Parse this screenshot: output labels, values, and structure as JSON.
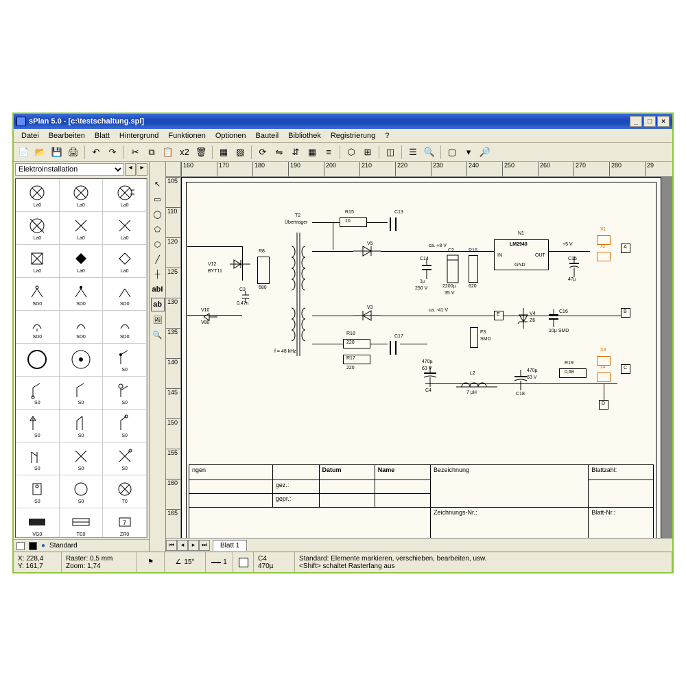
{
  "window": {
    "title": "sPlan 5.0 - [c:\\testschaltung.spl]",
    "min": "_",
    "max": "□",
    "close": "×"
  },
  "menu": [
    "Datei",
    "Bearbeiten",
    "Blatt",
    "Hintergrund",
    "Funktionen",
    "Optionen",
    "Bauteil",
    "Bibliothek",
    "Registrierung",
    "?"
  ],
  "library": {
    "selected": "Elektroinstallation",
    "components": [
      "La0",
      "La0",
      "La0",
      "La0",
      "La0",
      "La0",
      "La0",
      "La0",
      "La0",
      "SD0",
      "SD0",
      "SD0",
      "SD0",
      "SD0",
      "SD0",
      " ",
      " ",
      "S0",
      "S0",
      "S0",
      "S0",
      "S0",
      "S0",
      "S0",
      "S0",
      "S0",
      "S0",
      "S0",
      "S0",
      "T0",
      "VG0",
      "TE0",
      "ZR0"
    ]
  },
  "left_bottom": {
    "layer": "Standard"
  },
  "ruler_top": [
    "160",
    "170",
    "180",
    "190",
    "200",
    "210",
    "220",
    "230",
    "240",
    "250",
    "260",
    "270",
    "280",
    "29"
  ],
  "ruler_left": [
    "105",
    "110",
    "120",
    "125",
    "130",
    "135",
    "140",
    "145",
    "150",
    "155",
    "160",
    "165"
  ],
  "sheet_tab": "Blatt 1",
  "status": {
    "pos_x": "X: 228,4",
    "pos_y": "Y: 161,7",
    "raster": "Raster: 0,5 mm",
    "zoom": "Zoom:   1,74",
    "angle": "15°",
    "thick_lbl": "1",
    "sel_name": "C4",
    "sel_val": "470µ",
    "help1": "Standard: Elemente markieren, verschieben, bearbeiten, usw.",
    "help2": "<Shift> schaltet Rasterfang aus"
  },
  "schematic": {
    "t2": "T2",
    "t2s": "Übertrager",
    "r15": "R15",
    "r15v": "10",
    "c13": "C13",
    "v12": "V12",
    "v12v": "BYT11",
    "r8": "R8",
    "r8v": "680",
    "c3": "C3",
    "c3v": "0,47n",
    "v10": "V10",
    "v10v": "V80",
    "freq": "f = 48 kHz",
    "v5": "V5",
    "v3": "V3",
    "ca1": "ca. +8 V",
    "ca2": "ca. -41 V",
    "c14": "C14",
    "c14v": "1µ",
    "c14r": "250 V",
    "c2": "C2",
    "c2v": "2200µ",
    "c2r": "35 V",
    "r16": "R16",
    "r16v": "620",
    "n1": "N1",
    "n1ic": "LM2940",
    "n1in": "IN",
    "n1out": "OUT",
    "n1gnd": "GND",
    "v5out": "+5 V",
    "c15": "C15",
    "c15v": "47µ",
    "x1": "X1",
    "x2": "X2",
    "xa": "A",
    "e": "E",
    "b": "B",
    "v4": "V4",
    "v4v": "Z6",
    "c16": "C16",
    "c16v": "10µ SMD",
    "r18": "R18",
    "r18v": "220",
    "r17": "R17",
    "r17v": "220",
    "c17": "C17",
    "f3": "F3",
    "f3v": "SMD",
    "c4": "C4",
    "c4v": "470µ",
    "c4r": "63 V",
    "l2": "L2",
    "l2v": "7 µH",
    "c18": "C18",
    "c18v": "470µ",
    "c18r": "63 V",
    "r19": "R19",
    "r19v": "0,68",
    "x3": "X3",
    "x4": "X4",
    "xc": "C",
    "d": "D"
  },
  "title_block": {
    "hdr_change": "ngen",
    "hdr_datum": "Datum",
    "hdr_name": "Name",
    "hdr_bez": "Bezeichnung",
    "hdr_blattz": "Blattzahl:",
    "gez": "gez.:",
    "gepr": "gepr.:",
    "znr": "Zeichnungs-Nr.:",
    "blatt": "Blatt-Nr.:"
  }
}
